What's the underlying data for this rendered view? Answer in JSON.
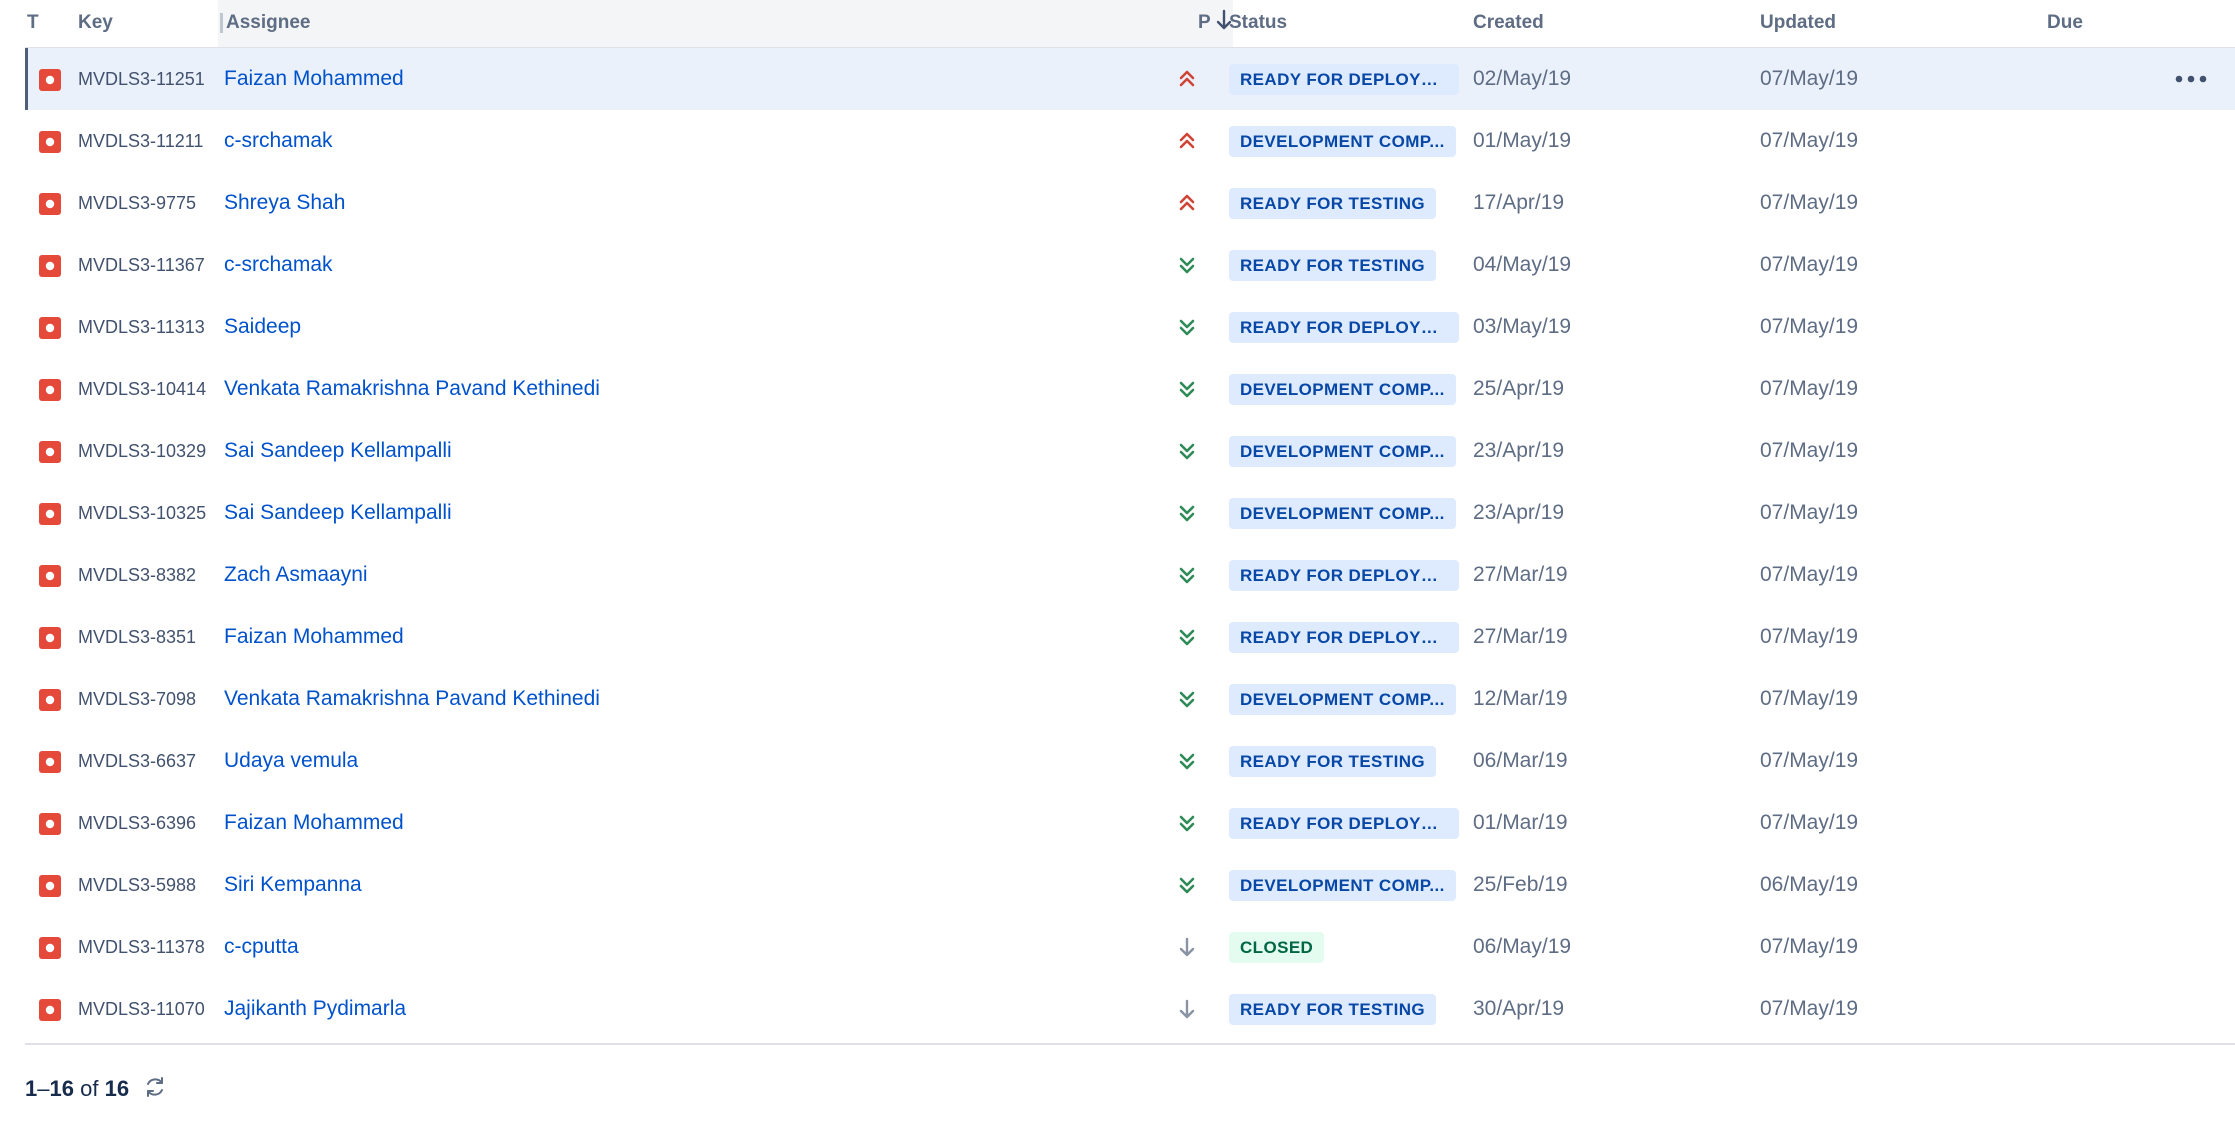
{
  "columns": {
    "type": "T",
    "key": "Key",
    "assignee": "Assignee",
    "priority": "P",
    "status": "Status",
    "created": "Created",
    "updated": "Updated",
    "due": "Due"
  },
  "rows": [
    {
      "key": "MVDLS3-11251",
      "assignee": "Faizan Mohammed",
      "priority": "highest",
      "status": "READY FOR DEPLOYM...",
      "status_color": "blue",
      "created": "02/May/19",
      "updated": "07/May/19"
    },
    {
      "key": "MVDLS3-11211",
      "assignee": "c-srchamak",
      "priority": "highest",
      "status": "DEVELOPMENT COMP...",
      "status_color": "blue",
      "created": "01/May/19",
      "updated": "07/May/19"
    },
    {
      "key": "MVDLS3-9775",
      "assignee": "Shreya Shah",
      "priority": "highest",
      "status": "READY FOR TESTING",
      "status_color": "blue",
      "created": "17/Apr/19",
      "updated": "07/May/19"
    },
    {
      "key": "MVDLS3-11367",
      "assignee": "c-srchamak",
      "priority": "lowest",
      "status": "READY FOR TESTING",
      "status_color": "blue",
      "created": "04/May/19",
      "updated": "07/May/19"
    },
    {
      "key": "MVDLS3-11313",
      "assignee": "Saideep",
      "priority": "lowest",
      "status": "READY FOR DEPLOYM...",
      "status_color": "blue",
      "created": "03/May/19",
      "updated": "07/May/19"
    },
    {
      "key": "MVDLS3-10414",
      "assignee": "Venkata Ramakrishna Pavand Kethinedi",
      "priority": "lowest",
      "status": "DEVELOPMENT COMP...",
      "status_color": "blue",
      "created": "25/Apr/19",
      "updated": "07/May/19"
    },
    {
      "key": "MVDLS3-10329",
      "assignee": "Sai Sandeep Kellampalli",
      "priority": "lowest",
      "status": "DEVELOPMENT COMP...",
      "status_color": "blue",
      "created": "23/Apr/19",
      "updated": "07/May/19"
    },
    {
      "key": "MVDLS3-10325",
      "assignee": "Sai Sandeep Kellampalli",
      "priority": "lowest",
      "status": "DEVELOPMENT COMP...",
      "status_color": "blue",
      "created": "23/Apr/19",
      "updated": "07/May/19"
    },
    {
      "key": "MVDLS3-8382",
      "assignee": "Zach Asmaayni",
      "priority": "lowest",
      "status": "READY FOR DEPLOYM...",
      "status_color": "blue",
      "created": "27/Mar/19",
      "updated": "07/May/19"
    },
    {
      "key": "MVDLS3-8351",
      "assignee": "Faizan Mohammed",
      "priority": "lowest",
      "status": "READY FOR DEPLOYM...",
      "status_color": "blue",
      "created": "27/Mar/19",
      "updated": "07/May/19"
    },
    {
      "key": "MVDLS3-7098",
      "assignee": "Venkata Ramakrishna Pavand Kethinedi",
      "priority": "lowest",
      "status": "DEVELOPMENT COMP...",
      "status_color": "blue",
      "created": "12/Mar/19",
      "updated": "07/May/19"
    },
    {
      "key": "MVDLS3-6637",
      "assignee": "Udaya vemula",
      "priority": "lowest",
      "status": "READY FOR TESTING",
      "status_color": "blue",
      "created": "06/Mar/19",
      "updated": "07/May/19"
    },
    {
      "key": "MVDLS3-6396",
      "assignee": "Faizan Mohammed",
      "priority": "lowest",
      "status": "READY FOR DEPLOYM...",
      "status_color": "blue",
      "created": "01/Mar/19",
      "updated": "07/May/19"
    },
    {
      "key": "MVDLS3-5988",
      "assignee": "Siri Kempanna",
      "priority": "lowest",
      "status": "DEVELOPMENT COMP...",
      "status_color": "blue",
      "created": "25/Feb/19",
      "updated": "06/May/19"
    },
    {
      "key": "MVDLS3-11378",
      "assignee": "c-cputta",
      "priority": "low",
      "status": "CLOSED",
      "status_color": "green",
      "created": "06/May/19",
      "updated": "07/May/19"
    },
    {
      "key": "MVDLS3-11070",
      "assignee": "Jajikanth Pydimarla",
      "priority": "low",
      "status": "READY FOR TESTING",
      "status_color": "blue",
      "created": "30/Apr/19",
      "updated": "07/May/19"
    }
  ],
  "pagination": {
    "start": "1",
    "end": "16",
    "of_label": "of",
    "total": "16"
  },
  "colors": {
    "issue_type": "#e5493a",
    "priority_highest": "#d04437",
    "priority_lowest": "#2e8b57",
    "priority_low": "#8993a4",
    "link": "#0052cc",
    "selected_row": "#eaf1fb"
  },
  "icons": {
    "issue_type": "bug-icon",
    "sort": "arrow-down-icon",
    "row_actions": "more-horizontal-icon",
    "refresh": "refresh-icon"
  }
}
